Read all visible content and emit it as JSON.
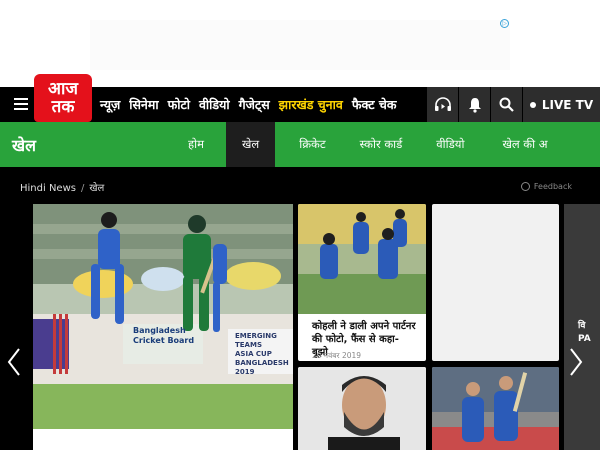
{
  "ad": {
    "choice_icon": "adchoices-icon"
  },
  "nav": {
    "logo_line1": "आज",
    "logo_line2": "तक",
    "links": [
      {
        "label": "न्यूज़",
        "highlight": false
      },
      {
        "label": "सिनेमा",
        "highlight": false
      },
      {
        "label": "फोटो",
        "highlight": false
      },
      {
        "label": "वीडियो",
        "highlight": false
      },
      {
        "label": "गैजेट्स",
        "highlight": false
      },
      {
        "label": "झारखंड चुनाव",
        "highlight": true
      },
      {
        "label": "फैक्ट चेक",
        "highlight": false
      }
    ],
    "live_label": "LIVE TV"
  },
  "section": {
    "title": "खेल",
    "tabs": [
      {
        "label": "होम",
        "active": false
      },
      {
        "label": "खेल",
        "active": true
      },
      {
        "label": "क्रिकेट",
        "active": false
      },
      {
        "label": "स्कोर कार्ड",
        "active": false
      },
      {
        "label": "वीडियो",
        "active": false
      },
      {
        "label": "खेल की अ",
        "active": false
      }
    ]
  },
  "breadcrumb": {
    "home": "Hindi News",
    "current": "खेल"
  },
  "feedback_label": "Feedback",
  "hero": {
    "caption": "",
    "banner_line1": "EMERGING TEAMS",
    "banner_line2": "ASIA CUP",
    "banner_line3": "BANGLADESH 2019",
    "board_line1": "Bangladesh",
    "board_line2": "Cricket Board"
  },
  "cards": [
    {
      "title": "कोहली ने डाली अपने पार्टनर की फोटो, फैंस से कहा- बूझो",
      "date": "20 नवंबर 2019"
    }
  ],
  "peek_text": "वि\nPA",
  "colors": {
    "brand_red": "#e4111b",
    "section_green": "#29a33b",
    "highlight_yellow": "#ffd500"
  }
}
